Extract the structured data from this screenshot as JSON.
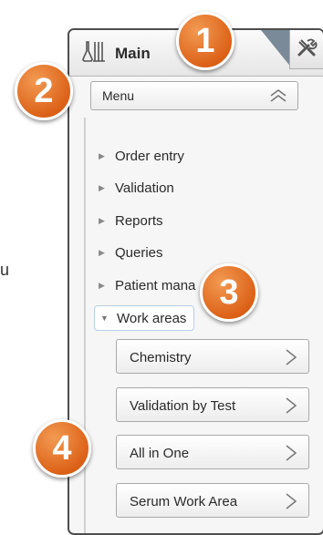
{
  "stray_char": "u",
  "panel": {
    "title": "Main",
    "icons": {
      "app": "flask-icon",
      "tools": "tools-icon"
    }
  },
  "menu": {
    "label": "Menu",
    "collapse_icon": "double-chevron-up-icon"
  },
  "nav_items": [
    {
      "label": "Order entry",
      "expanded": false
    },
    {
      "label": "Validation",
      "expanded": false
    },
    {
      "label": "Reports",
      "expanded": false
    },
    {
      "label": "Queries",
      "expanded": false
    },
    {
      "label": "Patient mana",
      "expanded": false
    },
    {
      "label": "Work areas",
      "expanded": true
    }
  ],
  "work_areas": [
    {
      "label": "Chemistry"
    },
    {
      "label": "Validation by Test"
    },
    {
      "label": "All in One"
    },
    {
      "label": "Serum Work Area"
    }
  ],
  "callouts": [
    "1",
    "2",
    "3",
    "4"
  ],
  "colors": {
    "badge": "#e0661c",
    "border": "#4e4e4e",
    "selected_outline": "#b7cfe4"
  }
}
